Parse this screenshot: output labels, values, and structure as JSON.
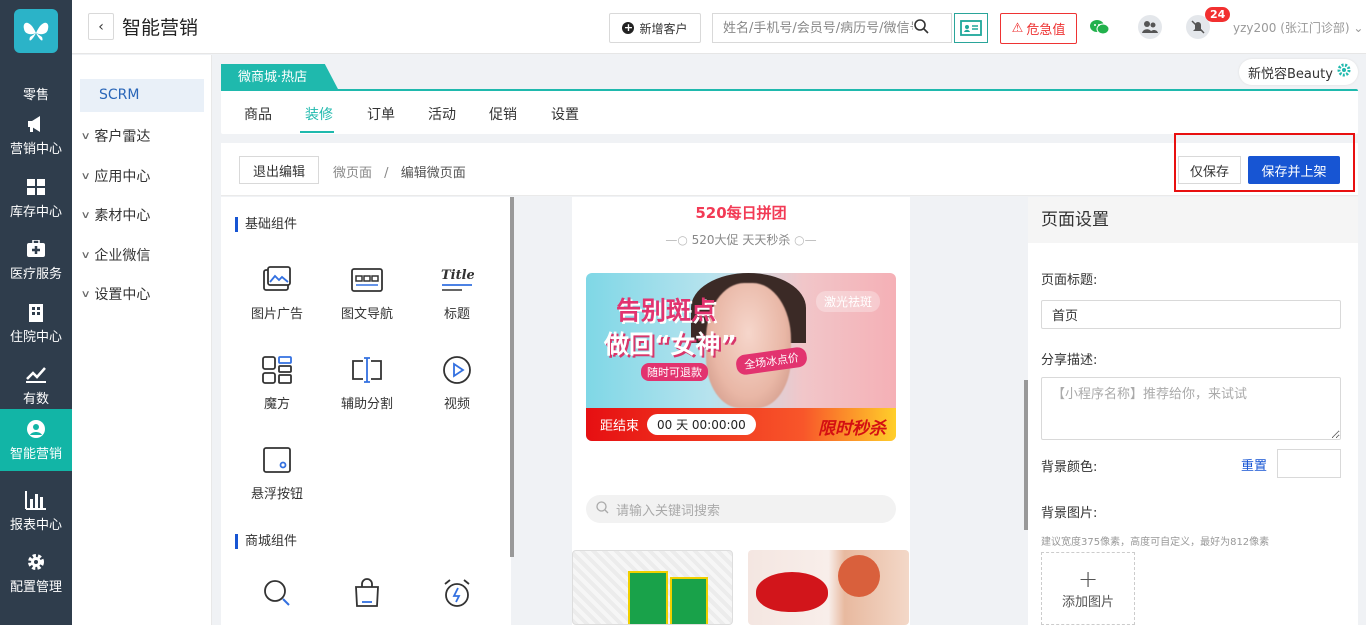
{
  "header": {
    "title": "智能营销",
    "new_customer": "新增客户",
    "search_placeholder": "姓名/手机号/会员号/病历号/微信号",
    "danger_label": "危急值",
    "badge_count": "24",
    "user": "yzy200 (张江门诊部)"
  },
  "nav": {
    "items": [
      {
        "label": "零售",
        "icon": "butterfly-logo-icon"
      },
      {
        "label": "营销中心",
        "icon": "megaphone-icon"
      },
      {
        "label": "库存中心",
        "icon": "grid-icon"
      },
      {
        "label": "医疗服务",
        "icon": "medical-kit-icon"
      },
      {
        "label": "住院中心",
        "icon": "building-icon"
      },
      {
        "label": "有数",
        "icon": "trend-chart-icon"
      },
      {
        "label": "智能营销",
        "icon": "smart-marketing-icon"
      },
      {
        "label": "报表中心",
        "icon": "bar-chart-icon"
      },
      {
        "label": "配置管理",
        "icon": "gear-icon"
      }
    ]
  },
  "submenu": {
    "active": "SCRM",
    "items": [
      "客户雷达",
      "应用中心",
      "素材中心",
      "企业微信",
      "设置中心"
    ]
  },
  "shop": {
    "tag": "微商城·热店",
    "name": "新悦容Beauty"
  },
  "tabs": [
    "商品",
    "装修",
    "订单",
    "活动",
    "促销",
    "设置"
  ],
  "active_tab": "装修",
  "editbar": {
    "exit": "退出编辑",
    "crumb1": "微页面",
    "sep": "/",
    "crumb2": "编辑微页面",
    "save_only": "仅保存",
    "save_publish": "保存并上架"
  },
  "components": {
    "basic_title": "基础组件",
    "basic": [
      {
        "label": "图片广告",
        "icon": "image-ad-icon"
      },
      {
        "label": "图文导航",
        "icon": "image-nav-icon"
      },
      {
        "label": "标题",
        "icon": "title-icon"
      },
      {
        "label": "魔方",
        "icon": "cube-icon"
      },
      {
        "label": "辅助分割",
        "icon": "divider-icon"
      },
      {
        "label": "视频",
        "icon": "video-icon"
      },
      {
        "label": "悬浮按钮",
        "icon": "float-button-icon"
      }
    ],
    "mall_title": "商城组件"
  },
  "preview": {
    "title": "520每日拼团",
    "subtitle": "520大促 天天秒杀",
    "banner_line1": "告别斑点",
    "banner_line2": "做回“女神”",
    "banner_tag": "激光祛斑",
    "banner_price": "全场冰点价",
    "banner_refund": "随时可退款",
    "countdown_label": "距结束",
    "countdown_value": "00 天 00:00:00",
    "flash": "限时秒杀",
    "search_placeholder": "请输入关键词搜索"
  },
  "settings": {
    "heading": "页面设置",
    "page_title_label": "页面标题:",
    "page_title_value": "首页",
    "share_label": "分享描述:",
    "share_placeholder": "【小程序名称】推荐给你，来试试",
    "bg_color_label": "背景颜色:",
    "reset": "重置",
    "bg_image_label": "背景图片:",
    "hint": "建议宽度375像素，高度可自定义，最好为812像素",
    "add_image": "添加图片"
  },
  "colors": {
    "teal": "#1fb9ad",
    "nav_bg": "#2f3d4c",
    "primary": "#1755d3",
    "danger": "#e33333"
  }
}
